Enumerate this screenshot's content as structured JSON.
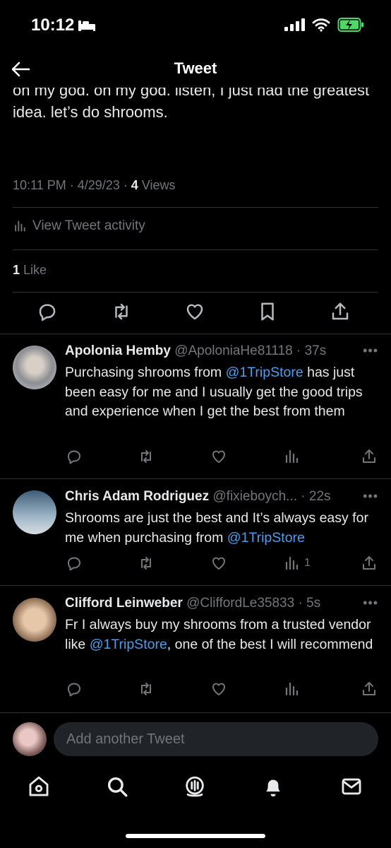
{
  "status": {
    "time": "10:12"
  },
  "header": {
    "title": "Tweet"
  },
  "tweet": {
    "text": "oh my god.  oh my god.  listen, I just had the greatest idea.  let’s do shrooms.",
    "time_date": "10:11 PM · 4/29/23 · ",
    "views_count": "4",
    "views_label": " Views",
    "activity_label": "View Tweet activity",
    "likes_count": "1",
    "likes_label": " Like"
  },
  "replies": [
    {
      "name": "Apolonia Hemby",
      "handle": "@ApoloniaHe81118 · 37s",
      "text_before": "Purchasing shrooms from ",
      "mention": "@1TripStore",
      "text_after": " has just been easy for me and I usually get the good trips and experience when I get the best from them",
      "views": ""
    },
    {
      "name": "Chris Adam Rodriguez",
      "handle": "@fixieboych... · 22s",
      "text_before": "Shrooms are just the best and It’s always easy for me when purchasing from ",
      "mention": "@1TripStore",
      "text_after": "",
      "views": "1"
    },
    {
      "name": "Clifford Leinweber",
      "handle": "@CliffordLe35833 · 5s",
      "text_before": "Fr I always buy my shrooms from a trusted vendor like ",
      "mention": "@1TripStore",
      "text_after": ", one of the best I will recommend",
      "views": ""
    }
  ],
  "compose": {
    "placeholder": "Add another Tweet"
  },
  "more_label": "•••",
  "colors": {
    "accent": "#4c9eeb",
    "muted": "#71767b",
    "battery": "#4cd964"
  },
  "icons": [
    "back-arrow-icon",
    "reply-icon",
    "retweet-icon",
    "like-icon",
    "bookmark-icon",
    "share-icon",
    "views-icon",
    "home-icon",
    "search-icon",
    "spaces-icon",
    "bell-icon",
    "mail-icon"
  ]
}
